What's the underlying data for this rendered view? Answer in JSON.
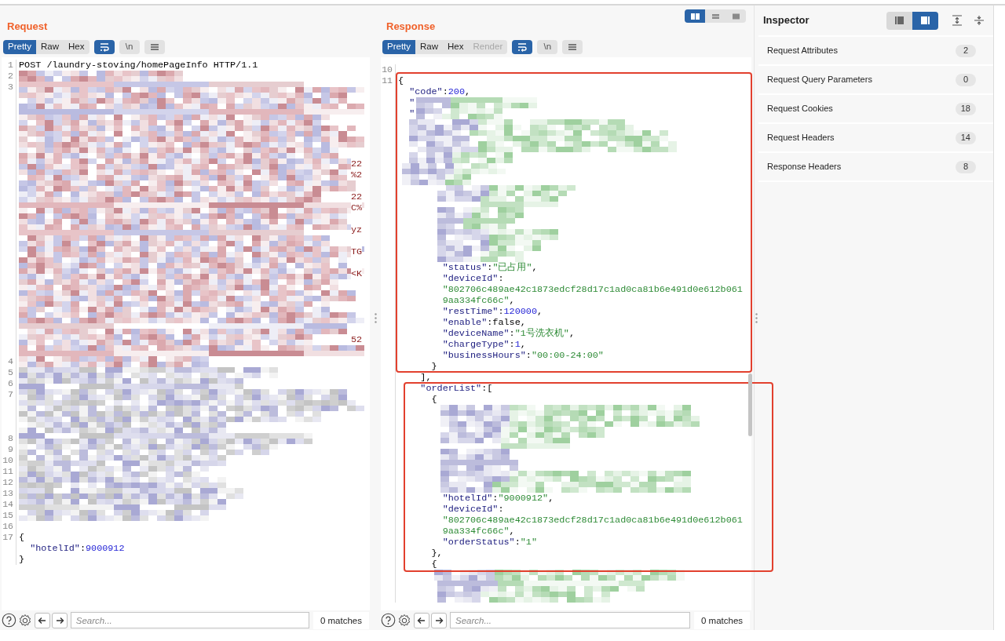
{
  "layout_toggle": [
    {
      "kind": "columns",
      "selected": true
    },
    {
      "kind": "rows",
      "selected": false
    },
    {
      "kind": "single",
      "selected": false
    }
  ],
  "request": {
    "title": "Request",
    "view_tabs": [
      {
        "label": "Pretty",
        "selected": true,
        "disabled": false
      },
      {
        "label": "Raw",
        "selected": false,
        "disabled": false
      },
      {
        "label": "Hex",
        "selected": false,
        "disabled": false
      }
    ],
    "tools": [
      {
        "kind": "wrap",
        "on": true
      },
      {
        "kind": "newline",
        "label": "\\n",
        "on": false
      },
      {
        "kind": "menu",
        "on": false
      }
    ],
    "lines": [
      {
        "number": "1",
        "segments": [
          {
            "text": "POST /laundry-stoving/homePageInfo HTTP/1.1",
            "kind": "plain"
          }
        ]
      },
      {
        "number": "2",
        "kind": "redacted"
      },
      {
        "number": "3",
        "kind": "redacted"
      },
      {
        "kind": "redacted"
      },
      {
        "kind": "redacted"
      },
      {
        "kind": "redacted"
      },
      {
        "kind": "redacted"
      },
      {
        "kind": "redacted"
      },
      {
        "kind": "redacted"
      },
      {
        "kind": "redacted",
        "tail": "22"
      },
      {
        "kind": "redacted",
        "tail": "%2"
      },
      {
        "kind": "redacted"
      },
      {
        "kind": "redacted",
        "tail": "22"
      },
      {
        "kind": "redacted",
        "tail": "C%"
      },
      {
        "kind": "redacted"
      },
      {
        "kind": "redacted",
        "tail": "yz"
      },
      {
        "kind": "redacted"
      },
      {
        "kind": "redacted",
        "tail": "TG"
      },
      {
        "kind": "redacted"
      },
      {
        "kind": "redacted",
        "tail": "<K"
      },
      {
        "kind": "redacted"
      },
      {
        "kind": "redacted"
      },
      {
        "kind": "redacted"
      },
      {
        "kind": "redacted"
      },
      {
        "kind": "redacted"
      },
      {
        "kind": "redacted",
        "tail": "52"
      },
      {
        "kind": "redacted"
      },
      {
        "number": "4",
        "kind": "redacted"
      },
      {
        "number": "5",
        "kind": "redacted"
      },
      {
        "number": "6",
        "kind": "redacted"
      },
      {
        "number": "7",
        "kind": "redacted"
      },
      {
        "kind": "redacted"
      },
      {
        "kind": "redacted"
      },
      {
        "kind": "redacted"
      },
      {
        "number": "8",
        "kind": "redacted"
      },
      {
        "number": "9",
        "kind": "redacted"
      },
      {
        "number": "10",
        "kind": "redacted"
      },
      {
        "number": "11",
        "kind": "redacted"
      },
      {
        "number": "12",
        "kind": "redacted"
      },
      {
        "number": "13",
        "kind": "redacted"
      },
      {
        "number": "14",
        "kind": "redacted"
      },
      {
        "number": "15",
        "kind": "redacted"
      },
      {
        "number": "16"
      },
      {
        "number": "17",
        "segments": [
          {
            "text": "{",
            "kind": "plain"
          }
        ]
      },
      {
        "segments": [
          {
            "text": "  \"hotelId\"",
            "kind": "key"
          },
          {
            "text": ":",
            "kind": "plain"
          },
          {
            "text": "9000912",
            "kind": "number"
          }
        ]
      },
      {
        "segments": [
          {
            "text": "}",
            "kind": "plain"
          }
        ]
      }
    ],
    "search": {
      "placeholder": "Search..."
    },
    "matches": "0 matches"
  },
  "response": {
    "title": "Response",
    "view_tabs": [
      {
        "label": "Pretty",
        "selected": true,
        "disabled": false
      },
      {
        "label": "Raw",
        "selected": false,
        "disabled": false
      },
      {
        "label": "Hex",
        "selected": false,
        "disabled": false
      },
      {
        "label": "Render",
        "selected": false,
        "disabled": true
      }
    ],
    "tools": [
      {
        "kind": "wrap",
        "on": true
      },
      {
        "kind": "newline",
        "label": "\\n",
        "on": false
      },
      {
        "kind": "menu",
        "on": false
      }
    ],
    "lines": [
      {
        "number": "10"
      },
      {
        "number": "11",
        "segments": [
          {
            "text": "{",
            "kind": "plain"
          }
        ]
      },
      {
        "segments": [
          {
            "text": "  \"code\"",
            "kind": "key"
          },
          {
            "text": ":",
            "kind": "plain"
          },
          {
            "text": "200",
            "kind": "number"
          },
          {
            "text": ",",
            "kind": "plain"
          }
        ]
      },
      {
        "kind": "redacted",
        "segments": [
          {
            "text": "  \"",
            "kind": "key"
          }
        ]
      },
      {
        "kind": "redacted",
        "segments": [
          {
            "text": "  \"",
            "kind": "key"
          }
        ]
      },
      {
        "kind": "redacted"
      },
      {
        "kind": "redacted"
      },
      {
        "kind": "redacted"
      },
      {
        "kind": "redacted"
      },
      {
        "kind": "redacted"
      },
      {
        "kind": "redacted"
      },
      {
        "kind": "redacted"
      },
      {
        "kind": "redacted"
      },
      {
        "kind": "redacted"
      },
      {
        "kind": "redacted"
      },
      {
        "kind": "redacted"
      },
      {
        "kind": "redacted"
      },
      {
        "kind": "redacted"
      },
      {
        "segments": [
          {
            "text": "        \"status\"",
            "kind": "key"
          },
          {
            "text": ":",
            "kind": "plain"
          },
          {
            "text": "\"已占用\"",
            "kind": "string"
          },
          {
            "text": ",",
            "kind": "plain"
          }
        ]
      },
      {
        "segments": [
          {
            "text": "        \"deviceId\"",
            "kind": "key"
          },
          {
            "text": ":",
            "kind": "plain"
          }
        ]
      },
      {
        "segments": [
          {
            "text": "        \"802706c489ae42c1873edcf28d17c1ad0ca81b6e491d0e612b061",
            "kind": "string"
          }
        ]
      },
      {
        "segments": [
          {
            "text": "        9aa334fc66c\"",
            "kind": "string"
          },
          {
            "text": ",",
            "kind": "plain"
          }
        ]
      },
      {
        "segments": [
          {
            "text": "        \"restTime\"",
            "kind": "key"
          },
          {
            "text": ":",
            "kind": "plain"
          },
          {
            "text": "120000",
            "kind": "number"
          },
          {
            "text": ",",
            "kind": "plain"
          }
        ]
      },
      {
        "segments": [
          {
            "text": "        \"enable\"",
            "kind": "key"
          },
          {
            "text": ":false,",
            "kind": "plain"
          }
        ]
      },
      {
        "segments": [
          {
            "text": "        \"deviceName\"",
            "kind": "key"
          },
          {
            "text": ":",
            "kind": "plain"
          },
          {
            "text": "\"1号洗衣机\"",
            "kind": "string"
          },
          {
            "text": ",",
            "kind": "plain"
          }
        ]
      },
      {
        "segments": [
          {
            "text": "        \"chargeType\"",
            "kind": "key"
          },
          {
            "text": ":",
            "kind": "plain"
          },
          {
            "text": "1",
            "kind": "number"
          },
          {
            "text": ",",
            "kind": "plain"
          }
        ]
      },
      {
        "segments": [
          {
            "text": "        \"businessHours\"",
            "kind": "key"
          },
          {
            "text": ":",
            "kind": "plain"
          },
          {
            "text": "\"00:00-24:00\"",
            "kind": "string"
          }
        ]
      },
      {
        "segments": [
          {
            "text": "      }",
            "kind": "plain"
          }
        ]
      },
      {
        "segments": [
          {
            "text": "    ],",
            "kind": "plain"
          }
        ]
      },
      {
        "segments": [
          {
            "text": "    \"orderList\"",
            "kind": "key"
          },
          {
            "text": ":[",
            "kind": "plain"
          }
        ]
      },
      {
        "segments": [
          {
            "text": "      {",
            "kind": "plain"
          }
        ]
      },
      {
        "kind": "redacted"
      },
      {
        "kind": "redacted"
      },
      {
        "kind": "redacted"
      },
      {
        "kind": "redacted"
      },
      {
        "kind": "redacted"
      },
      {
        "kind": "redacted"
      },
      {
        "kind": "redacted"
      },
      {
        "kind": "redacted"
      },
      {
        "segments": [
          {
            "text": "        \"hotelId\"",
            "kind": "key"
          },
          {
            "text": ":",
            "kind": "plain"
          },
          {
            "text": "\"9000912\"",
            "kind": "string"
          },
          {
            "text": ",",
            "kind": "plain"
          }
        ]
      },
      {
        "segments": [
          {
            "text": "        \"deviceId\"",
            "kind": "key"
          },
          {
            "text": ":",
            "kind": "plain"
          }
        ]
      },
      {
        "segments": [
          {
            "text": "        \"802706c489ae42c1873edcf28d17c1ad0ca81b6e491d0e612b061",
            "kind": "string"
          }
        ]
      },
      {
        "segments": [
          {
            "text": "        9aa334fc66c\"",
            "kind": "string"
          },
          {
            "text": ",",
            "kind": "plain"
          }
        ]
      },
      {
        "segments": [
          {
            "text": "        \"orderStatus\"",
            "kind": "key"
          },
          {
            "text": ":",
            "kind": "plain"
          },
          {
            "text": "\"1\"",
            "kind": "string"
          }
        ]
      },
      {
        "segments": [
          {
            "text": "      },",
            "kind": "plain"
          }
        ]
      },
      {
        "segments": [
          {
            "text": "      {",
            "kind": "plain"
          }
        ]
      },
      {
        "kind": "redacted"
      },
      {
        "kind": "redacted"
      },
      {
        "kind": "redacted"
      }
    ],
    "search": {
      "placeholder": "Search..."
    },
    "matches": "0 matches"
  },
  "inspector": {
    "title": "Inspector",
    "view_toggle": [
      {
        "kind": "left",
        "selected": false
      },
      {
        "kind": "right",
        "selected": true
      }
    ],
    "sections": [
      {
        "label": "Request Attributes",
        "count": "2"
      },
      {
        "label": "Request Query Parameters",
        "count": "0"
      },
      {
        "label": "Request Cookies",
        "count": "18"
      },
      {
        "label": "Request Headers",
        "count": "14"
      },
      {
        "label": "Response Headers",
        "count": "8"
      }
    ]
  }
}
